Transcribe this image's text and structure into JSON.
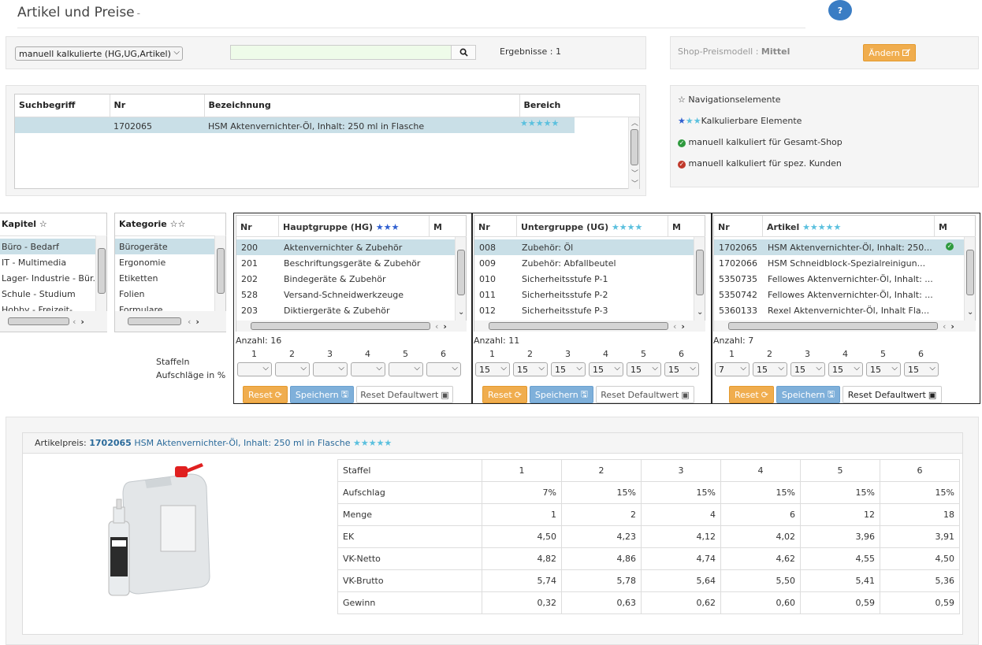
{
  "header": {
    "title": "Artikel und Preise",
    "dash": "-",
    "help": "?"
  },
  "search": {
    "mode": "manuell kalkulierte (HG,UG,Artikel)",
    "placeholder": "",
    "results_label": "Ergebnisse : 1"
  },
  "shop": {
    "label": "Shop-Preismodell :",
    "value": "Mittel",
    "change": "Ändern"
  },
  "results": {
    "columns": [
      "Suchbegriff",
      "Nr",
      "Bezeichnung",
      "Bereich"
    ],
    "rows": [
      {
        "suchbegriff": "",
        "nr": "1702065",
        "bezeichnung": "HSM Aktenvernichter-Öl, Inhalt: 250 ml in Flasche",
        "bereich": "★★★★★"
      }
    ]
  },
  "legend": {
    "nav": "Navigationselemente",
    "calc": "Kalkulierbare Elemente",
    "manual_shop": "manuell kalkuliert für Gesamt-Shop",
    "manual_customer": "manuell kalkuliert für spez. Kunden"
  },
  "kapitel": {
    "title": "Kapitel",
    "items": [
      "Büro - Bedarf",
      "IT - Multimedia",
      "Lager- Industrie - Bür.",
      "Schule - Studium",
      "Hobby - Freizeit- Feste"
    ]
  },
  "kategorie": {
    "title": "Kategorie",
    "items": [
      "Bürogeräte",
      "Ergonomie",
      "Etiketten",
      "Folien",
      "Formulare"
    ]
  },
  "hauptgruppe": {
    "cols": [
      "Nr",
      "Hauptgruppe (HG)",
      "M"
    ],
    "rows": [
      [
        "200",
        "Aktenvernichter & Zubehör"
      ],
      [
        "201",
        "Beschriftungsgeräte & Zubehör"
      ],
      [
        "202",
        "Bindegeräte & Zubehör"
      ],
      [
        "528",
        "Versand-Schneidwerkzeuge"
      ],
      [
        "203",
        "Diktiergeräte & Zubehör"
      ]
    ],
    "count": "Anzahl: 16",
    "staffel": [
      "1",
      "2",
      "3",
      "4",
      "5",
      "6"
    ],
    "values": [
      "",
      "",
      "",
      "",
      "",
      ""
    ]
  },
  "untergruppe": {
    "cols": [
      "Nr",
      "Untergruppe (UG)",
      "M"
    ],
    "rows": [
      [
        "008",
        "Zubehör: Öl"
      ],
      [
        "009",
        "Zubehör: Abfallbeutel"
      ],
      [
        "010",
        "Sicherheitsstufe P-1"
      ],
      [
        "011",
        "Sicherheitsstufe P-2"
      ],
      [
        "012",
        "Sicherheitsstufe P-3"
      ]
    ],
    "count": "Anzahl: 11",
    "staffel": [
      "1",
      "2",
      "3",
      "4",
      "5",
      "6"
    ],
    "values": [
      "15",
      "15",
      "15",
      "15",
      "15",
      "15"
    ]
  },
  "artikel": {
    "cols": [
      "Nr",
      "Artikel",
      "M"
    ],
    "rows": [
      [
        "1702065",
        "HSM Aktenvernichter-Öl, Inhalt: 250..."
      ],
      [
        "1702066",
        "HSM Schneidblock-Spezialreinigun..."
      ],
      [
        "5350735",
        "Fellowes Aktenvernichter-Öl, Inhalt: ..."
      ],
      [
        "5350742",
        "Fellowes Aktenvernichter-Öl, Inhalt: ..."
      ],
      [
        "5360133",
        "Rexel Aktenvernichter-Öl, Inhalt Fla..."
      ]
    ],
    "count": "Anzahl: 7",
    "staffel": [
      "1",
      "2",
      "3",
      "4",
      "5",
      "6"
    ],
    "values": [
      "7",
      "15",
      "15",
      "15",
      "15",
      "15"
    ]
  },
  "staffeln_label": "Staffeln",
  "aufschlaege_label": "Aufschläge in %",
  "buttons": {
    "reset": "Reset",
    "save": "Speichern",
    "reset_default": "Reset Defaultwert"
  },
  "price": {
    "label": "Artikelpreis:",
    "nr": "1702065",
    "name": "HSM Aktenvernichter-Öl, Inhalt: 250 ml in Flasche",
    "stars": "★★★★★",
    "rows": [
      [
        "Staffel",
        "1",
        "2",
        "3",
        "4",
        "5",
        "6"
      ],
      [
        "Aufschlag",
        "7%",
        "15%",
        "15%",
        "15%",
        "15%",
        "15%"
      ],
      [
        "Menge",
        "1",
        "2",
        "4",
        "6",
        "12",
        "18"
      ],
      [
        "EK",
        "4,50",
        "4,23",
        "4,12",
        "4,02",
        "3,96",
        "3,91"
      ],
      [
        "VK-Netto",
        "4,82",
        "4,86",
        "4,74",
        "4,62",
        "4,55",
        "4,50"
      ],
      [
        "VK-Brutto",
        "5,74",
        "5,78",
        "5,64",
        "5,50",
        "5,41",
        "5,36"
      ],
      [
        "Gewinn",
        "0,32",
        "0,63",
        "0,62",
        "0,60",
        "0,59",
        "0,59"
      ]
    ]
  },
  "colors": {
    "accent": "#f0ad4e",
    "save": "#7fb0da",
    "selected_row": "#c9dfe7",
    "star": "#5bc0de",
    "star_nav": "#2f5fd0"
  }
}
